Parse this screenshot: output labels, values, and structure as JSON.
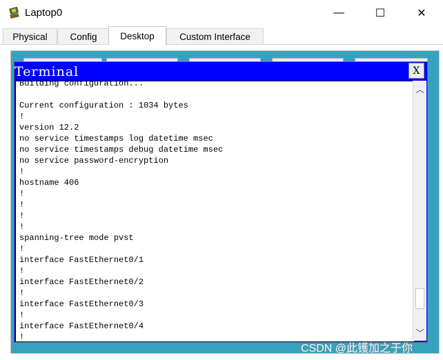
{
  "window": {
    "title": "Laptop0",
    "minimize_glyph": "—",
    "maximize_glyph": "☐",
    "close_glyph": "✕"
  },
  "tabs": [
    {
      "label": "Physical"
    },
    {
      "label": "Config"
    },
    {
      "label": "Desktop"
    },
    {
      "label": "Custom Interface"
    }
  ],
  "active_tab": "Desktop",
  "terminal": {
    "title": "Terminal",
    "close_label": "X",
    "lines": [
      "Building configuration...",
      "",
      "Current configuration : 1034 bytes",
      "!",
      "version 12.2",
      "no service timestamps log datetime msec",
      "no service timestamps debug datetime msec",
      "no service password-encryption",
      "!",
      "hostname 406",
      "!",
      "!",
      "!",
      "!",
      "spanning-tree mode pvst",
      "!",
      "interface FastEthernet0/1",
      "!",
      "interface FastEthernet0/2",
      "!",
      "interface FastEthernet0/3",
      "!",
      "interface FastEthernet0/4",
      "!"
    ]
  },
  "scrollbar": {
    "up_glyph": "︿",
    "down_glyph": "﹀"
  },
  "watermark": "CSDN @此镬加之于你",
  "colors": {
    "terminal_title_bar": "#0000ff",
    "desktop_background": "#37a2be"
  }
}
